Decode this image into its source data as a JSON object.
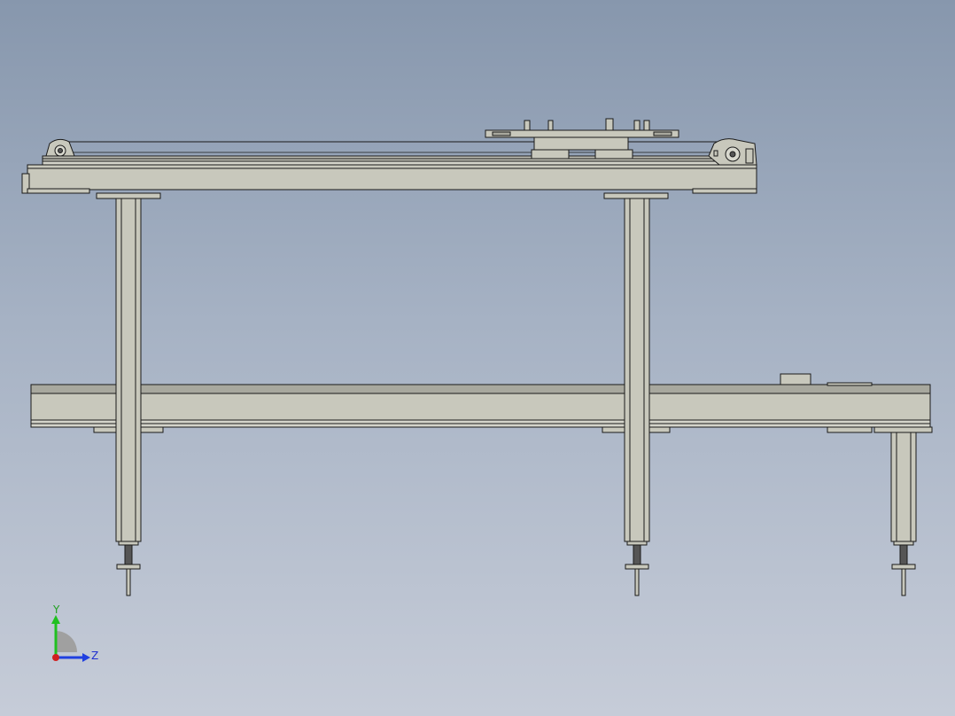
{
  "viewport": {
    "background_top": "#8797ad",
    "background_bottom": "#c6ccd8"
  },
  "model": {
    "description_icon": "conveyor-frame-assembly",
    "part_fill": "#c8c8bc",
    "part_edge": "#1a1a1a"
  },
  "triad": {
    "y_label": "Y",
    "z_label": "Z",
    "x_color": "#d02020",
    "y_color": "#20c020",
    "z_color": "#2040e0"
  }
}
